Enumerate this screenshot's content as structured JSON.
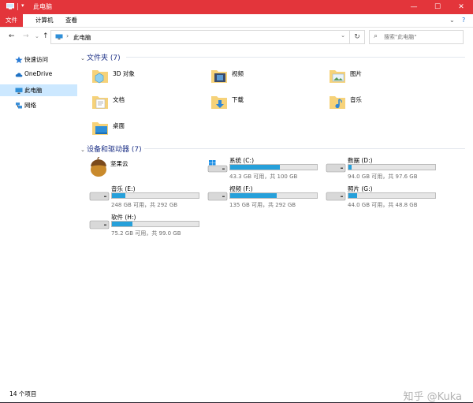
{
  "window": {
    "title": "此电脑",
    "accent": "#e3353b",
    "minimize": "—",
    "maximize": "☐",
    "close": "✕"
  },
  "ribbon": {
    "tabs": [
      "文件",
      "计算机",
      "查看"
    ]
  },
  "address": {
    "path": "此电脑",
    "search_placeholder": "搜索\"此电脑\""
  },
  "sidebar": {
    "items": [
      {
        "label": "快速访问",
        "icon": "star-icon"
      },
      {
        "label": "OneDrive",
        "icon": "cloud-icon"
      },
      {
        "label": "此电脑",
        "icon": "computer-icon",
        "selected": true
      },
      {
        "label": "网络",
        "icon": "network-icon"
      }
    ]
  },
  "folders": {
    "header": "文件夹 (7)",
    "items": [
      {
        "label": "3D 对象",
        "icon": "3d-objects-folder-icon"
      },
      {
        "label": "视频",
        "icon": "videos-folder-icon"
      },
      {
        "label": "图片",
        "icon": "pictures-folder-icon"
      },
      {
        "label": "文档",
        "icon": "documents-folder-icon"
      },
      {
        "label": "下载",
        "icon": "downloads-folder-icon"
      },
      {
        "label": "音乐",
        "icon": "music-folder-icon"
      },
      {
        "label": "桌面",
        "icon": "desktop-folder-icon"
      }
    ]
  },
  "drives": {
    "header": "设备和驱动器 (7)",
    "items": [
      {
        "label": "坚果云",
        "icon": "nutstore-icon"
      },
      {
        "label": "系统 (C:)",
        "info": "43.3 GB 可用，共 100 GB",
        "used": 0.57,
        "icon": "windows-drive-icon"
      },
      {
        "label": "数据 (D:)",
        "info": "94.0 GB 可用，共 97.6 GB",
        "used": 0.04,
        "icon": "drive-icon"
      },
      {
        "label": "音乐 (E:)",
        "info": "248 GB 可用，共 292 GB",
        "used": 0.15,
        "icon": "drive-icon"
      },
      {
        "label": "视频 (F:)",
        "info": "135 GB 可用，共 292 GB",
        "used": 0.54,
        "icon": "drive-icon"
      },
      {
        "label": "照片 (G:)",
        "info": "44.0 GB 可用，共 48.8 GB",
        "used": 0.1,
        "icon": "drive-icon"
      },
      {
        "label": "软件 (H:)",
        "info": "75.2 GB 可用，共 99.0 GB",
        "used": 0.24,
        "icon": "drive-icon"
      }
    ]
  },
  "status": {
    "count": "14 个项目"
  },
  "watermark": "知乎 @Kuka"
}
